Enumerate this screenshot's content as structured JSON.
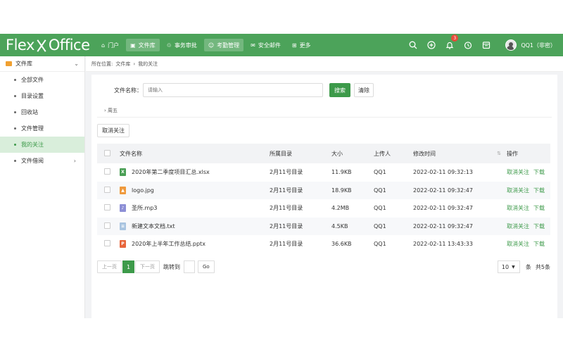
{
  "header": {
    "logo_left": "Flex",
    "logo_right": "Office",
    "nav": [
      {
        "label": "门户",
        "icon": "home-icon",
        "glyph": "⌂",
        "active": false
      },
      {
        "label": "文件库",
        "icon": "file-library-icon",
        "glyph": "▣",
        "active": true
      },
      {
        "label": "事务审批",
        "icon": "approval-icon",
        "glyph": "♲",
        "active": false
      },
      {
        "label": "考勤管理",
        "icon": "user-icon",
        "glyph": "☺",
        "active": true
      },
      {
        "label": "安全邮件",
        "icon": "mail-icon",
        "glyph": "✉",
        "active": false
      },
      {
        "label": "更多",
        "icon": "grid-icon",
        "glyph": "⊞",
        "active": false
      }
    ],
    "notification_count": "3",
    "user_name": "QQ1（非密）"
  },
  "sidebar": {
    "title": "文件库",
    "items": [
      {
        "label": "全部文件",
        "active": false
      },
      {
        "label": "目录设置",
        "active": false
      },
      {
        "label": "回收站",
        "active": false
      },
      {
        "label": "文件管理",
        "active": false
      },
      {
        "label": "我的关注",
        "active": true
      },
      {
        "label": "文件借阅",
        "active": false
      }
    ]
  },
  "breadcrumb": {
    "prefix": "所在位置:",
    "level1": "文件库",
    "sep": "›",
    "level2": "我的关注"
  },
  "search": {
    "label": "文件名称：",
    "placeholder": "请输入",
    "search_button": "搜索",
    "clear_button": "清除"
  },
  "filter_tag": "› 周五",
  "unfollow_all_button": "取消关注",
  "table": {
    "columns": [
      "文件名称",
      "所属目录",
      "大小",
      "上传人",
      "修改时间",
      "操作"
    ],
    "rows": [
      {
        "name": "2020年第二季度项目汇总.xlsx",
        "type": "xls",
        "glyph": "X",
        "dir": "2月11号目录",
        "size": "11.9KB",
        "uploader": "QQ1",
        "time": "2022-02-11 09:32:13"
      },
      {
        "name": "logo.jpg",
        "type": "img",
        "glyph": "▲",
        "dir": "2月11号目录",
        "size": "18.9KB",
        "uploader": "QQ1",
        "time": "2022-02-11 09:32:47"
      },
      {
        "name": "圣所.mp3",
        "type": "mp3",
        "glyph": "♪",
        "dir": "2月11号目录",
        "size": "4.2MB",
        "uploader": "QQ1",
        "time": "2022-02-11 09:32:47"
      },
      {
        "name": "新建文本文档.txt",
        "type": "txt",
        "glyph": "≡",
        "dir": "2月11号目录",
        "size": "4.5KB",
        "uploader": "QQ1",
        "time": "2022-02-11 09:32:47"
      },
      {
        "name": "2020年上半年工作总结.pptx",
        "type": "ppt",
        "glyph": "P",
        "dir": "2月11号目录",
        "size": "36.6KB",
        "uploader": "QQ1",
        "time": "2022-02-11 13:43:33"
      }
    ],
    "op_unfollow": "取消关注",
    "op_download": "下载"
  },
  "pagination": {
    "prev": "上一页",
    "current": "1",
    "next": "下一页",
    "jump_label": "跳转到",
    "go": "Go",
    "page_size": "10",
    "per_label": "条",
    "total": "共5条"
  },
  "colors": {
    "brand": "#4ca35a",
    "accent": "#3d9a4a",
    "badge": "#e74c3c"
  }
}
